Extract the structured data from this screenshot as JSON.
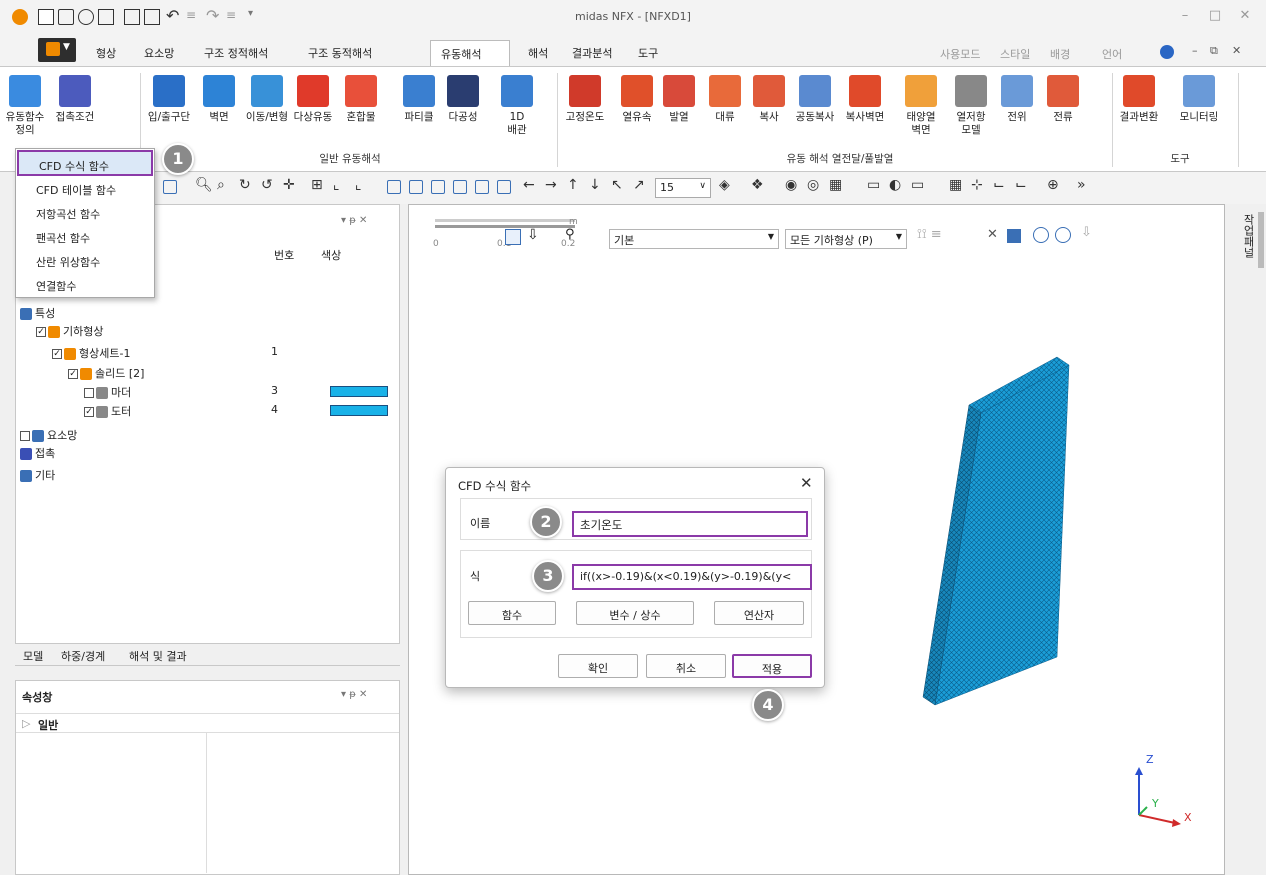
{
  "window": {
    "title": "midas NFX - [NFXD1]"
  },
  "menu": {
    "tabs": [
      "형상",
      "요소망",
      "구조 정적해석",
      "구조 동적해석",
      "유동해석",
      "해석",
      "결과분석",
      "도구"
    ],
    "right": [
      "사용모드",
      "스타일",
      "배경",
      "언어"
    ]
  },
  "ribbon": {
    "items": [
      {
        "label": "유동함수\n정의",
        "icon": "function-wave-icon",
        "color": "#3a8be0"
      },
      {
        "label": "접촉조건",
        "icon": "hourglass-icon",
        "color": "#4c5bbd"
      },
      {
        "label": "입/출구단",
        "icon": "inlet-outlet-icon",
        "color": "#2a6fc7"
      },
      {
        "label": "벽면",
        "icon": "wall-icon",
        "color": "#2d83d6"
      },
      {
        "label": "이동/변형",
        "icon": "moving-cylinder-icon",
        "color": "#3891d8"
      },
      {
        "label": "다상유동",
        "icon": "multiphase-icon",
        "color": "#e03a2a"
      },
      {
        "label": "혼합물",
        "icon": "mixture-icon",
        "color": "#e8503a"
      },
      {
        "label": "파티클",
        "icon": "particle-icon",
        "color": "#3a7fd0"
      },
      {
        "label": "다공성",
        "icon": "porous-icon",
        "color": "#2a3d70"
      },
      {
        "label": "1D\n배관",
        "icon": "pipe-icon",
        "color": "#3a7fd0"
      },
      {
        "label": "고정온도",
        "icon": "thermometer-icon",
        "color": "#d03a2a"
      },
      {
        "label": "열유속",
        "icon": "heat-flux-icon",
        "color": "#e0502a"
      },
      {
        "label": "발열",
        "icon": "heat-generation-icon",
        "color": "#d84a3a"
      },
      {
        "label": "대류",
        "icon": "convection-icon",
        "color": "#e86a3a"
      },
      {
        "label": "복사",
        "icon": "radiation-icon",
        "color": "#e05a3a"
      },
      {
        "label": "공동복사",
        "icon": "cavity-radiation-icon",
        "color": "#5a8ad0"
      },
      {
        "label": "복사벽면",
        "icon": "radiation-wall-icon",
        "color": "#e04a2a"
      },
      {
        "label": "태양열\n벽면",
        "icon": "solar-icon",
        "color": "#f0a03a"
      },
      {
        "label": "열저항\n모델",
        "icon": "thermal-resistance-icon",
        "color": "#888888"
      },
      {
        "label": "전위",
        "icon": "potential-icon",
        "color": "#6a9ad8"
      },
      {
        "label": "전류",
        "icon": "current-icon",
        "color": "#e05a3a"
      },
      {
        "label": "결과변환",
        "icon": "result-convert-icon",
        "color": "#e04a2a"
      },
      {
        "label": "모니터링",
        "icon": "monitoring-icon",
        "color": "#6a9ad8"
      }
    ],
    "groups": [
      "일반 유동해석",
      "유동 해석 열전달/풀발열",
      "도구"
    ]
  },
  "dropdown": {
    "items": [
      "CFD 수식 함수",
      "CFD 테이블 함수",
      "저항곡선 함수",
      "팬곡선 함수",
      "산란 위상함수",
      "연결함수"
    ]
  },
  "toolbar": {
    "zoom_value": "15"
  },
  "tree": {
    "headers": {
      "number": "번호",
      "color": "색상"
    },
    "rows": [
      {
        "label": "특성",
        "number": "",
        "indent": 0,
        "color": ""
      },
      {
        "label": "기하형상",
        "number": "",
        "indent": 1,
        "color": ""
      },
      {
        "label": "형상세트-1",
        "number": "1",
        "indent": 2,
        "color": ""
      },
      {
        "label": "솔리드 [2]",
        "number": "",
        "indent": 3,
        "color": ""
      },
      {
        "label": "마더",
        "number": "3",
        "indent": 4,
        "color": "#19b2e8"
      },
      {
        "label": "도터",
        "number": "4",
        "indent": 4,
        "color": "#19b2e8"
      },
      {
        "label": "요소망",
        "number": "",
        "indent": 0,
        "color": ""
      },
      {
        "label": "접촉",
        "number": "",
        "indent": 0,
        "color": ""
      },
      {
        "label": "기타",
        "number": "",
        "indent": 0,
        "color": ""
      }
    ]
  },
  "bottom_tabs": [
    "모델",
    "하중/경계",
    "해석 및 결과"
  ],
  "properties": {
    "title": "속성창",
    "section": "일반"
  },
  "viewport": {
    "scale_labels": [
      "0",
      "0.1",
      "0.2",
      "m"
    ],
    "view_style": "기본",
    "geometry_filter": "모든 기하형상 (P)",
    "side_tab": "작업패널",
    "axes": {
      "z": "Z",
      "y": "Y",
      "x": "X"
    }
  },
  "dialog": {
    "title": "CFD 수식 함수",
    "name_label": "이름",
    "name_value": "초기온도",
    "expr_label": "식",
    "expr_value": "if((x>-0.19)&(x<0.19)&(y>-0.19)&(y<",
    "btn_function": "함수",
    "btn_variable": "변수 / 상수",
    "btn_operator": "연산자",
    "btn_ok": "확인",
    "btn_cancel": "취소",
    "btn_apply": "적용"
  },
  "badges": [
    "1",
    "2",
    "3",
    "4"
  ]
}
